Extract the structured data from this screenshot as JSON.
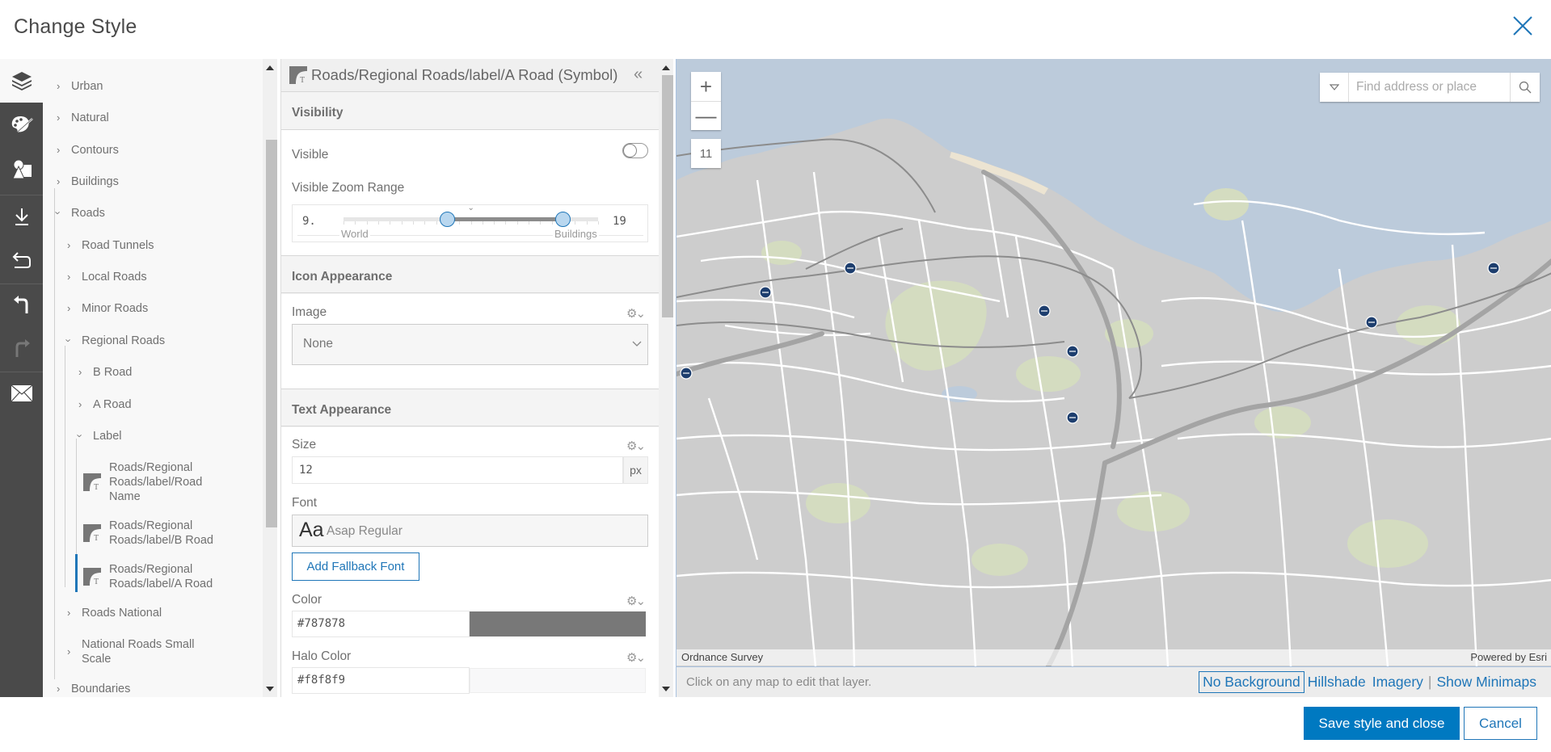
{
  "dialog": {
    "title": "Change Style",
    "close_icon": "close-x-icon"
  },
  "rail": {
    "items": [
      {
        "name": "layers",
        "icon": "layers-icon",
        "active": true
      },
      {
        "name": "style",
        "icon": "palette-icon",
        "active": false
      },
      {
        "name": "symbols",
        "icon": "shapes-icon",
        "active": false
      },
      {
        "name": "download",
        "icon": "download-icon",
        "active": false
      },
      {
        "name": "revert",
        "icon": "revert-icon",
        "active": false
      },
      {
        "name": "undo",
        "icon": "undo-icon",
        "active": false
      },
      {
        "name": "redo",
        "icon": "redo-icon",
        "active": false,
        "disabled": true
      },
      {
        "name": "feedback",
        "icon": "envelope-icon",
        "active": false
      }
    ]
  },
  "tree": {
    "items": [
      {
        "label": "Urban",
        "level": 0,
        "expanded": false
      },
      {
        "label": "Natural",
        "level": 0,
        "expanded": false
      },
      {
        "label": "Contours",
        "level": 0,
        "expanded": false
      },
      {
        "label": "Buildings",
        "level": 0,
        "expanded": false
      },
      {
        "label": "Roads",
        "level": 0,
        "expanded": true
      },
      {
        "label": "Road Tunnels",
        "level": 1,
        "expanded": false
      },
      {
        "label": "Local Roads",
        "level": 1,
        "expanded": false
      },
      {
        "label": "Minor Roads",
        "level": 1,
        "expanded": false
      },
      {
        "label": "Regional Roads",
        "level": 1,
        "expanded": true
      },
      {
        "label": "B Road",
        "level": 2,
        "expanded": false
      },
      {
        "label": "A Road",
        "level": 2,
        "expanded": false
      },
      {
        "label": "Label",
        "level": 2,
        "expanded": true
      },
      {
        "label": "Roads National",
        "level": 1,
        "expanded": false
      },
      {
        "label": "National Roads Small Scale",
        "level": 1,
        "expanded": false
      },
      {
        "label": "Boundaries",
        "level": 0,
        "expanded": false
      }
    ],
    "leaves": [
      {
        "label": "Roads/Regional Roads/label/Road Name",
        "icon": "text-symbol-icon",
        "selected": false
      },
      {
        "label": "Roads/Regional Roads/label/B Road",
        "icon": "text-symbol-icon",
        "selected": false
      },
      {
        "label": "Roads/Regional Roads/label/A Road",
        "icon": "text-symbol-icon",
        "selected": true
      }
    ]
  },
  "panel": {
    "title": "Roads/Regional Roads/label/A Road (Symbol)",
    "collapse_icon": "double-chevron-left-icon",
    "visibility": {
      "heading": "Visibility",
      "visible_label": "Visible",
      "visible_on": false,
      "zoom_range_label": "Visible Zoom Range",
      "min_zoom": "9.",
      "max_zoom": "19",
      "min_label": "World",
      "max_label": "Buildings",
      "range_min": 0,
      "range_max": 22,
      "min_value": 9,
      "max_value": 19,
      "current_zoom": 11
    },
    "icon_appearance": {
      "heading": "Icon Appearance",
      "image_label": "Image",
      "image_value": "None"
    },
    "text_appearance": {
      "heading": "Text Appearance",
      "size_label": "Size",
      "size_value": "12",
      "size_unit": "px",
      "font_label": "Font",
      "font_preview": "Aa",
      "font_value": "Asap Regular",
      "fallback_button": "Add Fallback Font",
      "color_label": "Color",
      "color_value": "#787878",
      "halo_label": "Halo Color",
      "halo_value": "#f8f8f9"
    }
  },
  "map": {
    "zoom_in": "+",
    "zoom_out": "—",
    "zoom_level": "11",
    "search_placeholder": "Find address or place",
    "attribution_left": "Ordnance Survey",
    "attribution_right": "Powered by Esri",
    "hint": "Click on any map to edit that layer.",
    "backgrounds": [
      {
        "label": "No Background",
        "selected": true
      },
      {
        "label": "Hillshade",
        "selected": false
      },
      {
        "label": "Imagery",
        "selected": false
      }
    ],
    "minimaps_label": "Show Minimaps",
    "colors": {
      "water": "#bccbdb",
      "land": "#cdcdcd",
      "park": "#d4dcc0",
      "road": "#ffffff",
      "major_road": "#a4a4a4",
      "rail": "#8c8c8c",
      "station": "#1d3e6e",
      "beach": "#ece4d2"
    }
  },
  "footer": {
    "save_label": "Save style and close",
    "cancel_label": "Cancel"
  },
  "colors": {
    "accent": "#0079c1",
    "rail_bg": "#4a4a4a",
    "selection_bar": "#1f76b8"
  }
}
